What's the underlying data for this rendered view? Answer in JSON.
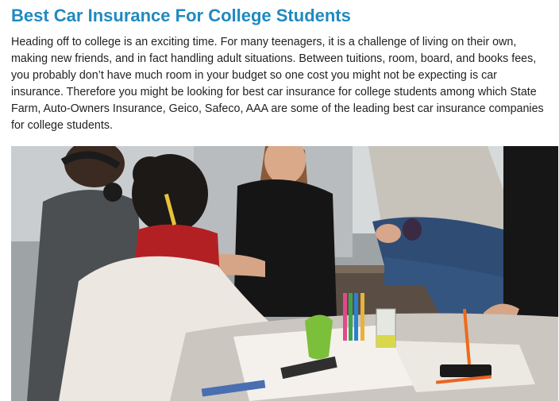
{
  "article": {
    "title": "Best Car Insurance For College Students",
    "body": "Heading off to college is an exciting time. For many teenagers, it is a challenge of living on their own, making new friends, and in fact handling adult situations. Between tuitions, room, board, and books fees, you probably don’t have much room in your budget so one cost you might not be expecting is car insurance. Therefore you might be looking for best car insurance for college students among which State Farm, Auto-Owners Insurance, Geico, Safeco, AAA are some of the leading best car insurance companies for college students."
  },
  "colors": {
    "title": "#1f8ac0",
    "text": "#222222"
  }
}
